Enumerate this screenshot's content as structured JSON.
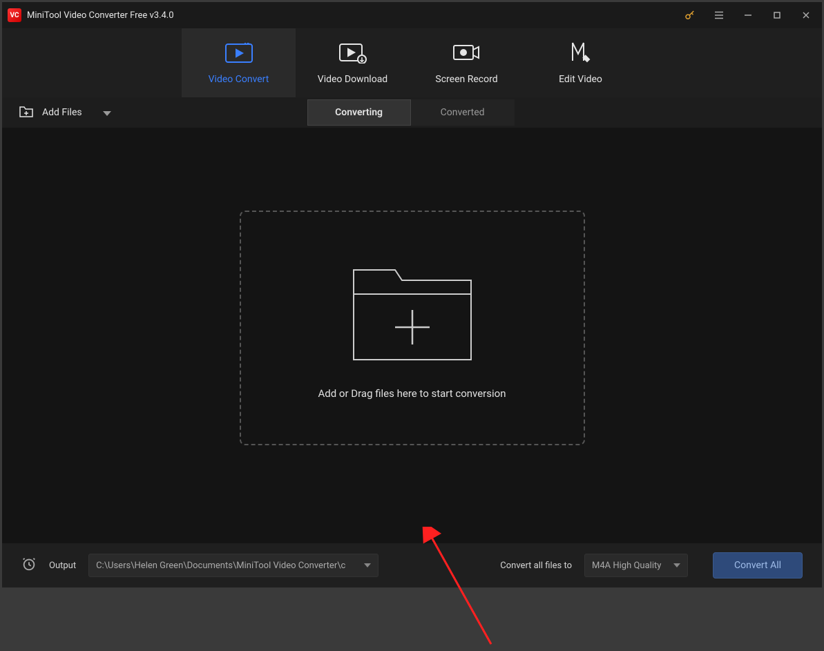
{
  "title": "MiniTool Video Converter Free v3.4.0",
  "nav": {
    "items": [
      {
        "id": "video-convert",
        "label": "Video Convert"
      },
      {
        "id": "video-download",
        "label": "Video Download"
      },
      {
        "id": "screen-record",
        "label": "Screen Record"
      },
      {
        "id": "edit-video",
        "label": "Edit Video"
      }
    ]
  },
  "toolbar": {
    "addFiles": "Add Files",
    "tabs": {
      "converting": "Converting",
      "converted": "Converted"
    }
  },
  "dropzone": {
    "text": "Add or Drag files here to start conversion"
  },
  "footer": {
    "outputLabel": "Output",
    "outputPath": "C:\\Users\\Helen Green\\Documents\\MiniTool Video Converter\\c",
    "convertToLabel": "Convert all files to",
    "formatValue": "M4A High Quality",
    "convertAll": "Convert All"
  }
}
